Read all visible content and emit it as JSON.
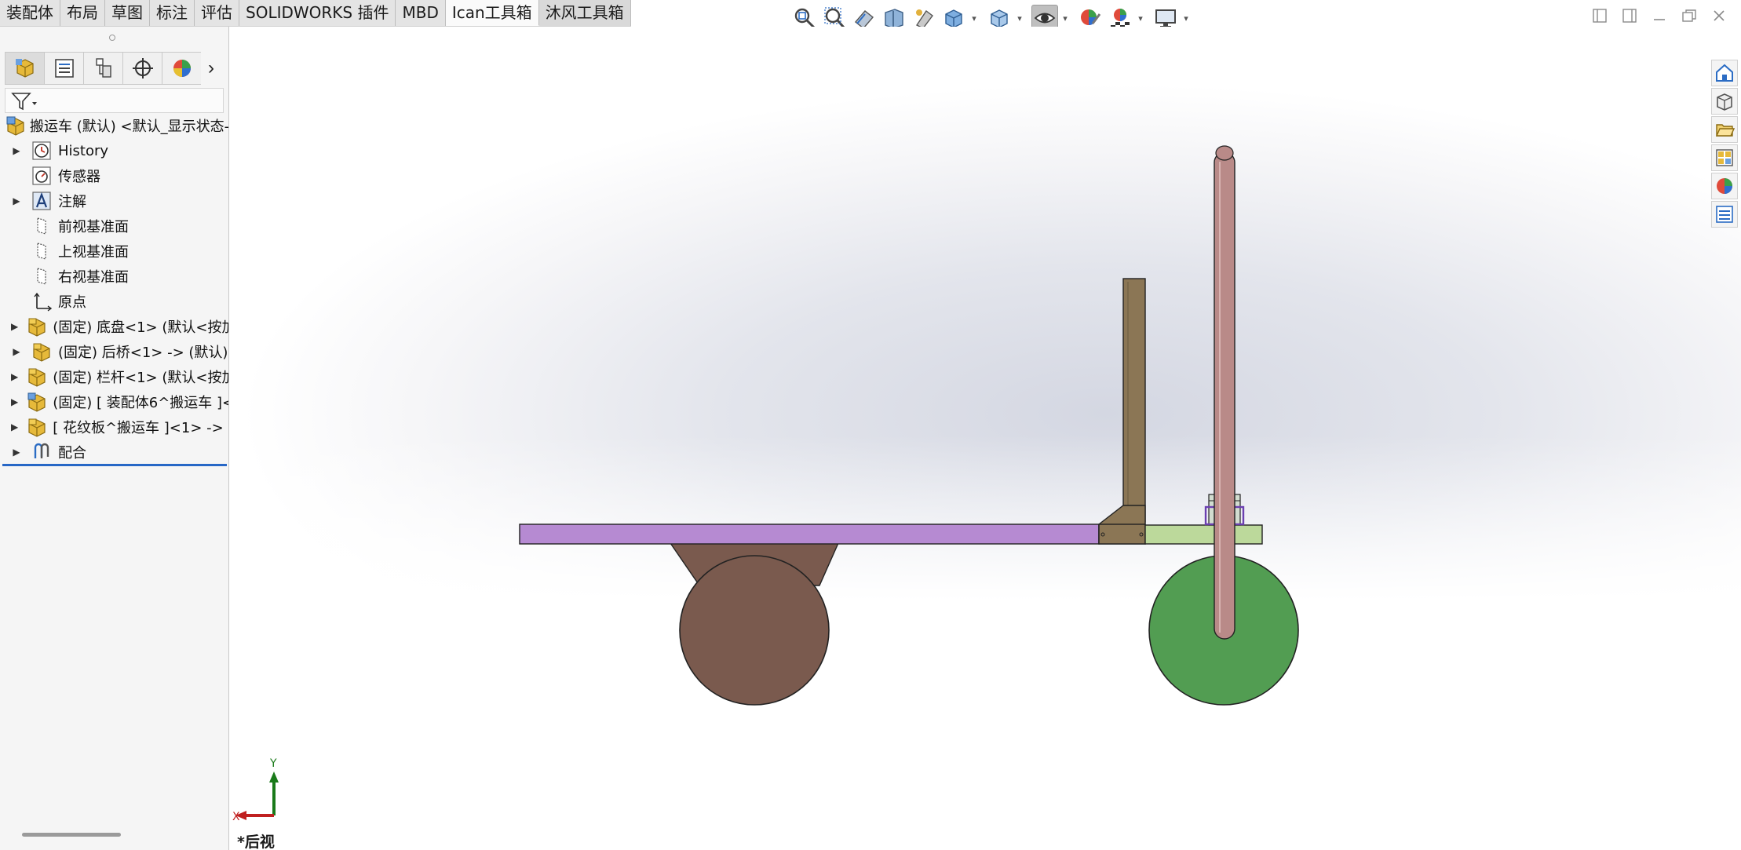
{
  "command_tabs": [
    "装配体",
    "布局",
    "草图",
    "标注",
    "评估",
    "SOLIDWORKS 插件",
    "MBD",
    "Ican工具箱",
    "沐风工具箱"
  ],
  "active_tab_index": 7,
  "hud_toolbar": [
    "zoom-to-fit-icon",
    "zoom-to-area-icon",
    "previous-view-icon",
    "section-view-icon",
    "dynamic-annotation-icon",
    "view-orientation-icon",
    "display-style-icon",
    "hide-show-items-icon",
    "edit-appearance-icon",
    "apply-scene-icon",
    "view-settings-icon"
  ],
  "panel_tabs": [
    "featuremanager-tree",
    "propertymanager",
    "configurationmanager",
    "dimxpertmanager",
    "displaymanager"
  ],
  "tree": {
    "root": "搬运车 (默认) <默认_显示状态-",
    "items": [
      {
        "label": "History",
        "expandable": true,
        "icon": "history-icon"
      },
      {
        "label": "传感器",
        "expandable": false,
        "icon": "sensor-icon"
      },
      {
        "label": "注解",
        "expandable": true,
        "icon": "annotation-icon"
      },
      {
        "label": "前视基准面",
        "expandable": false,
        "icon": "plane-icon"
      },
      {
        "label": "上视基准面",
        "expandable": false,
        "icon": "plane-icon"
      },
      {
        "label": "右视基准面",
        "expandable": false,
        "icon": "plane-icon"
      },
      {
        "label": "原点",
        "expandable": false,
        "icon": "origin-icon"
      },
      {
        "label": "(固定) 底盘<1> (默认<按加",
        "expandable": true,
        "icon": "part-icon"
      },
      {
        "label": "(固定) 后桥<1> -> (默认)",
        "expandable": true,
        "icon": "part-icon"
      },
      {
        "label": "(固定) 栏杆<1> (默认<按加",
        "expandable": true,
        "icon": "part-icon"
      },
      {
        "label": "(固定) [ 装配体6^搬运车 ]<",
        "expandable": true,
        "icon": "subassembly-icon"
      },
      {
        "label": "[ 花纹板^搬运车 ]<1> -> (",
        "expandable": true,
        "icon": "part-icon"
      },
      {
        "label": "配合",
        "expandable": true,
        "icon": "mates-icon"
      }
    ]
  },
  "triad": {
    "x_label": "X",
    "y_label": "Y"
  },
  "view_name": "*后视",
  "task_pane": [
    "solidworks-resources-icon",
    "design-library-icon",
    "file-explorer-icon",
    "view-palette-icon",
    "appearances-icon",
    "custom-properties-icon"
  ],
  "colors": {
    "platform": "#b68ad2",
    "frame": "#8b7655",
    "rail_post": "#8b7655",
    "rear_wheel": "#7a5a4e",
    "front_wheel": "#529d52",
    "front_plate": "#bcd99b",
    "handle": "#b98a88",
    "active_tab_underline": "#2767c6"
  }
}
